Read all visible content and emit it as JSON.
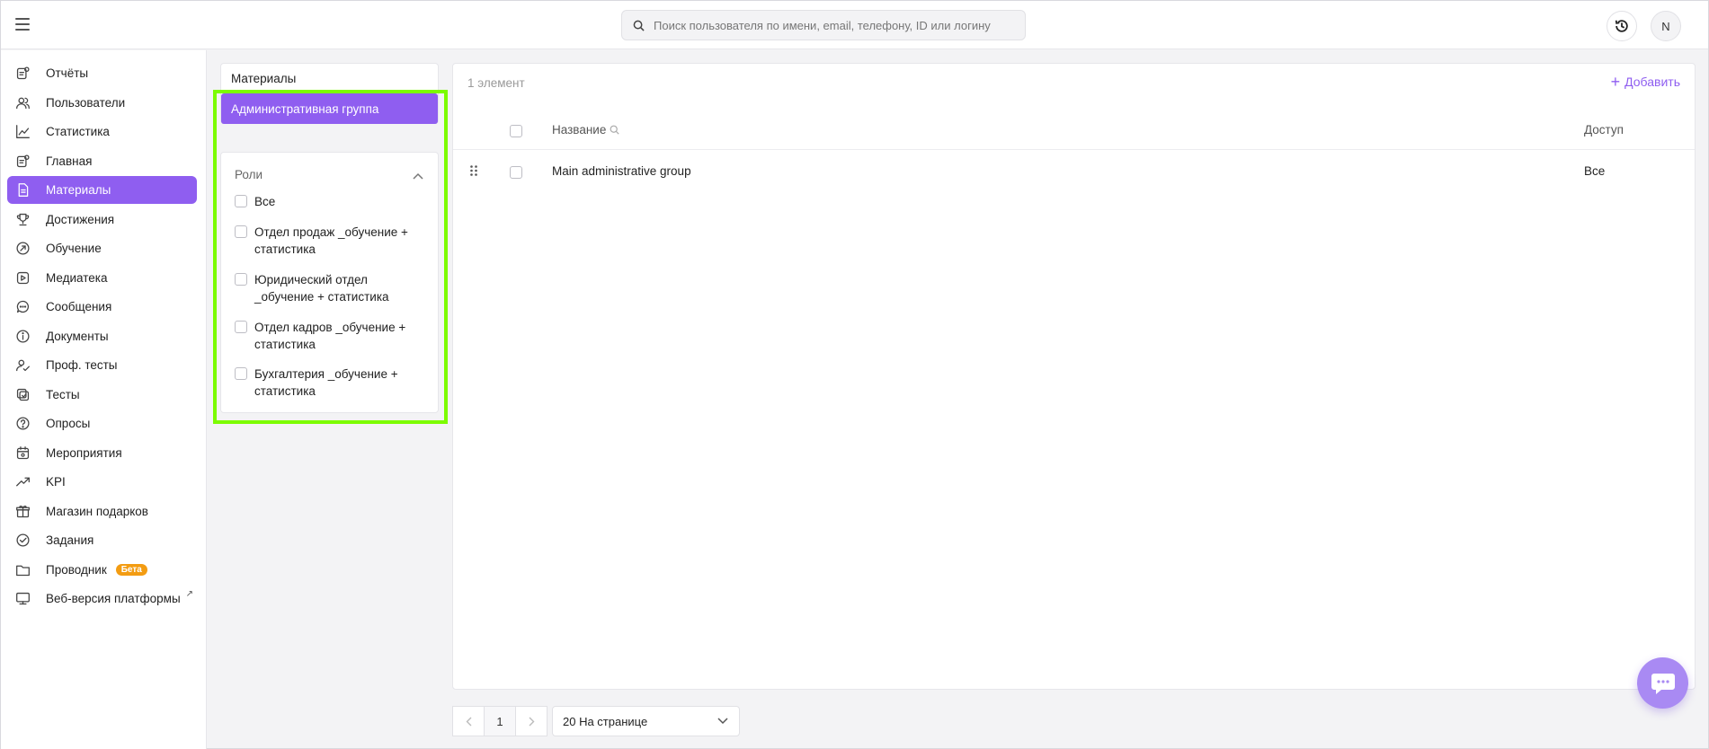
{
  "header": {
    "search_placeholder": "Поиск пользователя по имени, email, телефону, ID или логину",
    "avatar_initial": "N"
  },
  "sidebar": {
    "items": [
      {
        "label": "Отчёты",
        "icon": "report-icon"
      },
      {
        "label": "Пользователи",
        "icon": "users-icon"
      },
      {
        "label": "Статистика",
        "icon": "chart-icon"
      },
      {
        "label": "Главная",
        "icon": "home-icon"
      },
      {
        "label": "Материалы",
        "icon": "document-icon",
        "active": true
      },
      {
        "label": "Достижения",
        "icon": "trophy-icon"
      },
      {
        "label": "Обучение",
        "icon": "learning-icon"
      },
      {
        "label": "Медиатека",
        "icon": "media-icon"
      },
      {
        "label": "Сообщения",
        "icon": "message-icon"
      },
      {
        "label": "Документы",
        "icon": "info-icon"
      },
      {
        "label": "Проф. тесты",
        "icon": "user-check-icon"
      },
      {
        "label": "Тесты",
        "icon": "test-icon"
      },
      {
        "label": "Опросы",
        "icon": "question-icon"
      },
      {
        "label": "Мероприятия",
        "icon": "calendar-icon"
      },
      {
        "label": "KPI",
        "icon": "trend-icon"
      },
      {
        "label": "Магазин подарков",
        "icon": "gift-icon"
      },
      {
        "label": "Задания",
        "icon": "check-circle-icon"
      },
      {
        "label": "Проводник",
        "icon": "folder-icon",
        "badge": "Бета"
      },
      {
        "label": "Веб-версия платформы",
        "icon": "monitor-icon",
        "external": "↗"
      }
    ]
  },
  "groups": {
    "title": "Материалы",
    "active": "Административная группа"
  },
  "roles": {
    "title": "Роли",
    "items": [
      "Все",
      "Отдел продаж _обучение + статистика",
      "Юридический отдел _обучение + статистика",
      "Отдел кадров _обучение + статистика",
      "Бухгалтерия _обучение + статистика"
    ]
  },
  "table": {
    "count": "1 элемент",
    "add_label": "Добавить",
    "columns": {
      "name": "Название",
      "access": "Доступ"
    },
    "rows": [
      {
        "name": "Main administrative group",
        "access": "Все"
      }
    ]
  },
  "pagination": {
    "page": "1",
    "per_page": "20 На странице"
  },
  "colors": {
    "accent": "#8f5ef0",
    "highlight": "#7cfc00",
    "beta": "#f39c12",
    "chat": "#a98af3"
  }
}
